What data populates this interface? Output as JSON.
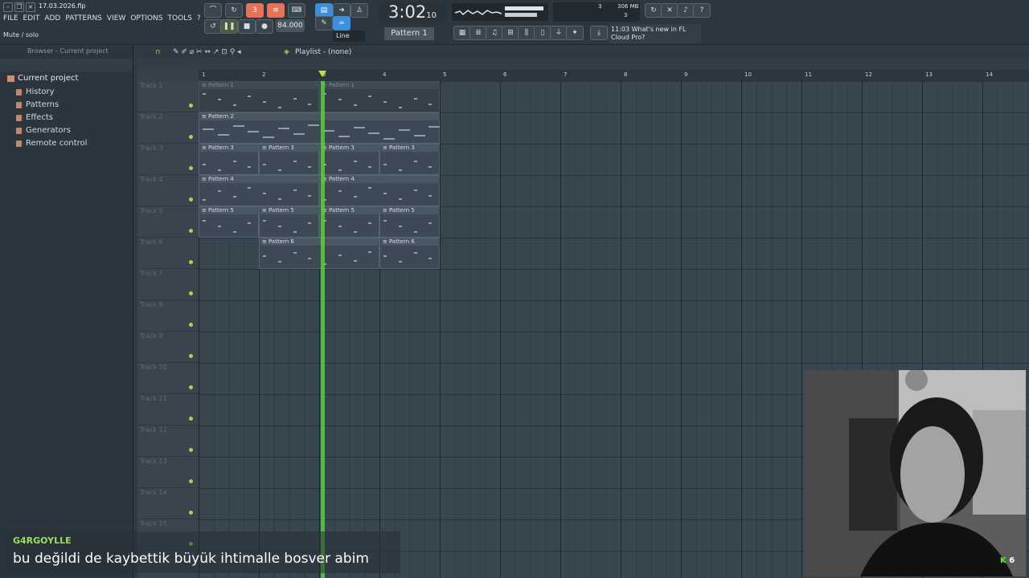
{
  "window": {
    "filename": "17.03.2026.flp",
    "hint": "Mute / solo"
  },
  "menu": [
    "FILE",
    "EDIT",
    "ADD",
    "PATTERNS",
    "VIEW",
    "OPTIONS",
    "TOOLS",
    "?"
  ],
  "transport": {
    "time": "3:02",
    "time_sub": "10",
    "tempo": "84.000",
    "pattern": "Pattern 1",
    "snap": "Line"
  },
  "cpu": {
    "memory": "306 MB",
    "voices": "3",
    "cores": "3"
  },
  "news": {
    "time": "11:03",
    "line1": "What's new in FL",
    "line2": "Cloud Pro?"
  },
  "browser": {
    "header": "Browser - Current project",
    "root": "Current project",
    "items": [
      "History",
      "Patterns",
      "Effects",
      "Generators",
      "Remote control"
    ]
  },
  "playlist": {
    "title": "Playlist - (none)",
    "bars": [
      "1",
      "2",
      "3",
      "4",
      "5",
      "6",
      "7",
      "8",
      "9",
      "10",
      "11",
      "12",
      "13",
      "14"
    ],
    "tracks": [
      "Track 1",
      "Track 2",
      "Track 3",
      "Track 4",
      "Track 5",
      "Track 6",
      "Track 7",
      "Track 8",
      "Track 9",
      "Track 10",
      "Track 11",
      "Track 12",
      "Track 13",
      "Track 14",
      "Track 15"
    ],
    "clips": [
      {
        "track": 0,
        "bar": 1,
        "len": 2,
        "name": "Pattern 1",
        "dim": true
      },
      {
        "track": 0,
        "bar": 3,
        "len": 2,
        "name": "Pattern 1",
        "dim": true
      },
      {
        "track": 1,
        "bar": 1,
        "len": 4,
        "name": "Pattern 2",
        "dim": false
      },
      {
        "track": 2,
        "bar": 1,
        "len": 1,
        "name": "Pattern 3",
        "dim": false
      },
      {
        "track": 2,
        "bar": 2,
        "len": 1,
        "name": "Pattern 3",
        "dim": false
      },
      {
        "track": 2,
        "bar": 3,
        "len": 1,
        "name": "Pattern 3",
        "dim": false
      },
      {
        "track": 2,
        "bar": 4,
        "len": 1,
        "name": "Pattern 3",
        "dim": false
      },
      {
        "track": 3,
        "bar": 1,
        "len": 2,
        "name": "Pattern 4",
        "dim": false
      },
      {
        "track": 3,
        "bar": 3,
        "len": 2,
        "name": "Pattern 4",
        "dim": false
      },
      {
        "track": 4,
        "bar": 1,
        "len": 1,
        "name": "Pattern 5",
        "dim": false
      },
      {
        "track": 4,
        "bar": 2,
        "len": 1,
        "name": "Pattern 5",
        "dim": false
      },
      {
        "track": 4,
        "bar": 3,
        "len": 1,
        "name": "Pattern 5",
        "dim": false
      },
      {
        "track": 4,
        "bar": 4,
        "len": 1,
        "name": "Pattern 5",
        "dim": false
      },
      {
        "track": 5,
        "bar": 2,
        "len": 2,
        "name": "Pattern 6",
        "dim": false
      },
      {
        "track": 5,
        "bar": 4,
        "len": 1,
        "name": "Pattern 6",
        "dim": false
      }
    ],
    "playhead_bar": 3.03
  },
  "chat": {
    "user": "G4RGOYLLE",
    "message": "bu değildi de kaybettik büyük ihtimalle bosver abim"
  },
  "kick": {
    "logo": "K",
    "viewers": "6"
  }
}
